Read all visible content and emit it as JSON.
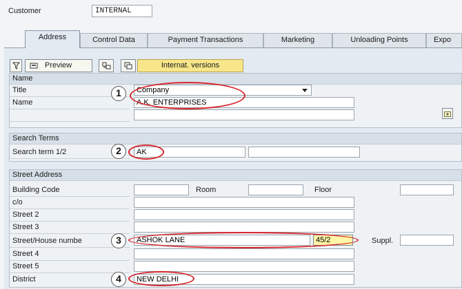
{
  "header": {
    "customer_label": "Customer",
    "customer_value": "INTERNAL"
  },
  "tabs": [
    {
      "label": "Address",
      "active": true
    },
    {
      "label": "Control Data"
    },
    {
      "label": "Payment Transactions"
    },
    {
      "label": "Marketing"
    },
    {
      "label": "Unloading Points"
    },
    {
      "label": "Expo"
    }
  ],
  "toolbar": {
    "preview_label": "Preview",
    "internat_label": "Internat. versions"
  },
  "name_group": {
    "title": "Name",
    "title_label": "Title",
    "title_value": "Company",
    "name_label": "Name",
    "name_value": "A.K. ENTERPRISES",
    "name2_value": ""
  },
  "search_group": {
    "title": "Search Terms",
    "label": "Search term 1/2",
    "term1": "AK",
    "term2": ""
  },
  "street_group": {
    "title": "Street Address",
    "building_label": "Building Code",
    "room_label": "Room",
    "floor_label": "Floor",
    "co_label": "c/o",
    "street2_label": "Street 2",
    "street3_label": "Street 3",
    "street_house_label": "Street/House numbe",
    "street_value": "ASHOK LANE",
    "house_value": "45/2",
    "suppl_label": "Suppl.",
    "street4_label": "Street 4",
    "street5_label": "Street 5",
    "district_label": "District",
    "district_value": "NEW DELHI"
  },
  "callouts": [
    "1",
    "2",
    "3",
    "4"
  ],
  "colors": {
    "callout_oval": "#d8262a",
    "active_field": "#fff6a8",
    "button_yellow": "#f7e68a"
  }
}
